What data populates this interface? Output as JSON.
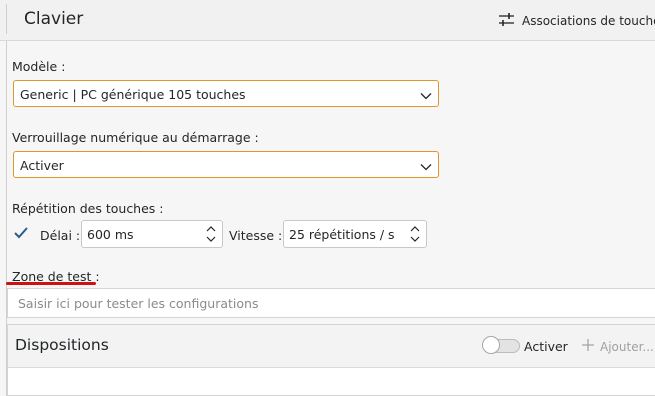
{
  "header": {
    "title": "Clavier",
    "associations_label": "Associations de touches"
  },
  "form": {
    "model_label": "Modèle :",
    "model_value": "Generic | PC générique 105 touches",
    "numlock_label": "Verrouillage numérique au démarrage :",
    "numlock_value": "Activer",
    "repeat_label": "Répétition des touches :",
    "repeat_checked": true,
    "delay_label": "Délai :",
    "delay_value": "600 ms",
    "speed_label": "Vitesse :",
    "speed_value": "25 répétitions / s",
    "test_label": "Zone de test :",
    "test_placeholder": "Saisir ici pour tester les configurations"
  },
  "layouts": {
    "title": "Dispositions",
    "toggle_label": "Activer",
    "toggle_on": false,
    "add_label": "Ajouter..."
  },
  "colors": {
    "focus_border": "#e0962f",
    "underline": "#d01111",
    "check": "#2c5b8f"
  }
}
